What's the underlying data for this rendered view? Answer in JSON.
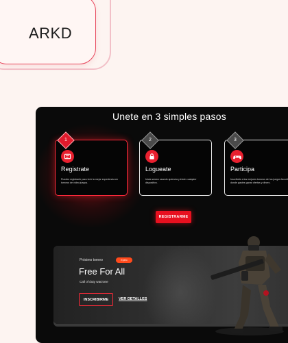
{
  "brand": {
    "title": "ARKD"
  },
  "section": {
    "title": "Unete en 3 simples pasos"
  },
  "steps": [
    {
      "number": "1",
      "name": "Registrate",
      "desc": "Puedes registrarte para vivir la mejor experiencia en torneos de video juegos.",
      "icon": "register-icon"
    },
    {
      "number": "2",
      "name": "Logueate",
      "desc": "Inicia sesion usando quiencia y inicie cualquier dispositivo.",
      "icon": "login-lock-icon"
    },
    {
      "number": "3",
      "name": "Participa",
      "desc": "Inscribete a los mejores torneos de los juegos favoritos donde gastes ganar ofertas y dinero.",
      "icon": "gamepad-icon"
    }
  ],
  "cta": {
    "label": "REGISTRARME"
  },
  "tournament": {
    "label": "Próximo torneo",
    "badge": "Epelo",
    "title": "Free For All",
    "game": "Call of duty warzone",
    "join_label": "INSCRIBIRME",
    "details_label": "VER DETALLES"
  },
  "colors": {
    "accent": "#e8101f",
    "panel": "#0a0a0a",
    "page": "#fdf4f1",
    "badge": "#ff4a1c"
  }
}
